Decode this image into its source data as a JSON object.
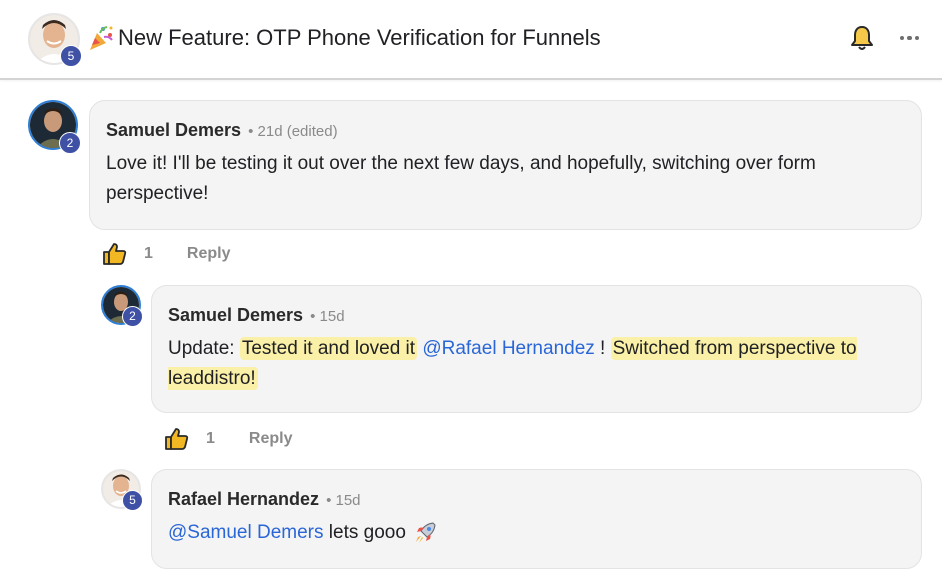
{
  "header": {
    "title": "New Feature: OTP Phone Verification for Funnels",
    "avatar_badge": "5",
    "icons": [
      "party-popper-icon",
      "bell-icon",
      "more-horizontal-icon"
    ]
  },
  "comments": [
    {
      "author": "Samuel Demers",
      "meta": "• 21d (edited)",
      "badge": "2",
      "text": "Love it! I'll be testing it out over the next few days, and hopefully, switching over form perspective!",
      "likes": "1",
      "reply_label": "Reply"
    },
    {
      "author": "Samuel Demers",
      "meta": "• 15d",
      "badge": "2",
      "parts": {
        "p1": "Update: ",
        "p2": "Tested it and loved it",
        "p3": "@Rafael Hernandez",
        "p4": " ! ",
        "p5": "Switched from perspective to leaddistro!"
      },
      "likes": "1",
      "reply_label": "Reply"
    },
    {
      "author": "Rafael Hernandez",
      "meta": "• 15d",
      "badge": "5",
      "parts": {
        "p1": "@Samuel Demers",
        "p2": " lets gooo "
      },
      "icons": [
        "rocket-icon"
      ]
    }
  ],
  "colors": {
    "badge": "#3f51a5",
    "mention": "#2a66d6",
    "highlight": "#fbf0a8",
    "like_icon": "#f2b824",
    "bubble": "#f4f4f4"
  }
}
